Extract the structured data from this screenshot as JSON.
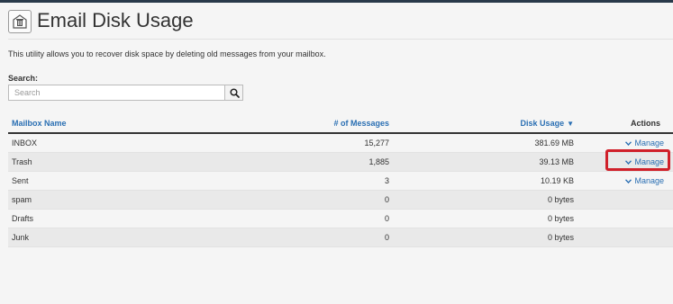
{
  "header": {
    "title": "Email Disk Usage",
    "icon": "trash-envelope-icon"
  },
  "description": "This utility allows you to recover disk space by deleting old messages from your mailbox.",
  "search": {
    "label": "Search:",
    "placeholder": "Search",
    "value": "",
    "button_icon": "search-icon"
  },
  "table": {
    "columns": {
      "name": "Mailbox Name",
      "messages": "# of Messages",
      "usage": "Disk Usage",
      "actions": "Actions"
    },
    "sort": {
      "column": "usage",
      "direction": "descending"
    },
    "rows": [
      {
        "name": "INBOX",
        "messages": "15,277",
        "usage": "381.69 MB",
        "action": "Manage"
      },
      {
        "name": "Trash",
        "messages": "1,885",
        "usage": "39.13 MB",
        "action": "Manage"
      },
      {
        "name": "Sent",
        "messages": "3",
        "usage": "10.19 KB",
        "action": "Manage"
      },
      {
        "name": "spam",
        "messages": "0",
        "usage": "0 bytes",
        "action": ""
      },
      {
        "name": "Drafts",
        "messages": "0",
        "usage": "0 bytes",
        "action": ""
      },
      {
        "name": "Junk",
        "messages": "0",
        "usage": "0 bytes",
        "action": ""
      }
    ]
  },
  "colors": {
    "topbar": "#293a4a",
    "link": "#2a6fb3",
    "highlight": "#d0202a",
    "row_alt": "#e9e9e9"
  }
}
